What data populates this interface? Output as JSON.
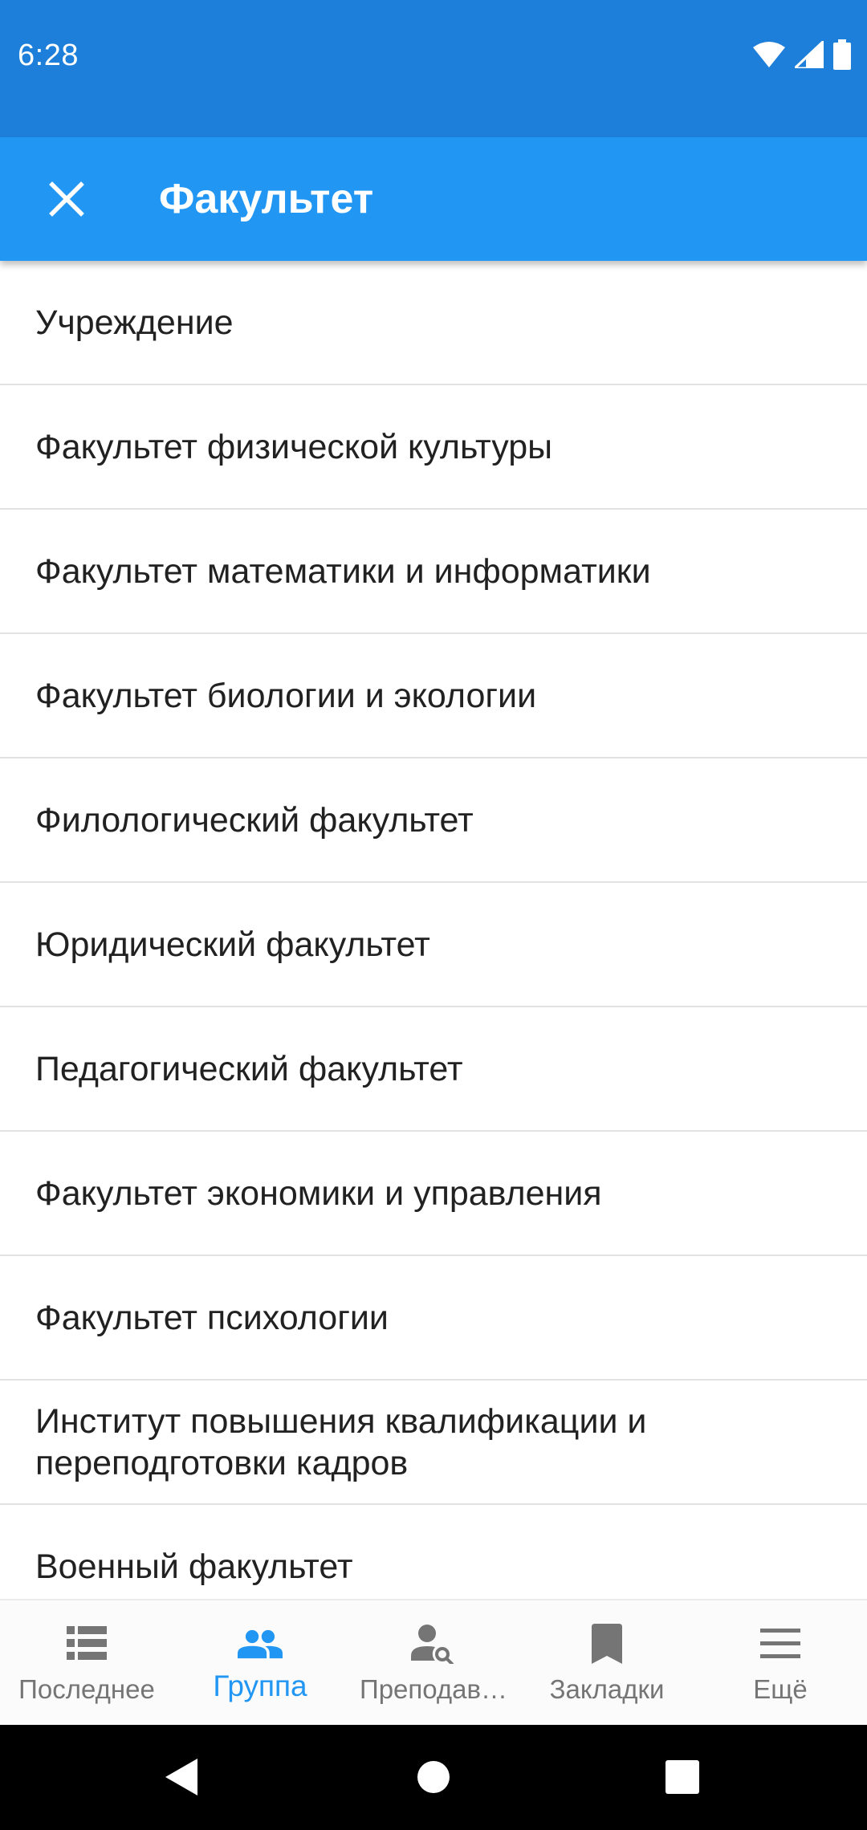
{
  "status_bar": {
    "time": "6:28",
    "icons": [
      "wifi-icon",
      "signal-icon",
      "battery-icon"
    ]
  },
  "app_bar": {
    "close_icon": "close-icon",
    "title": "Факультет"
  },
  "list": {
    "items": [
      {
        "label": "Учреждение"
      },
      {
        "label": "Факультет физической культуры"
      },
      {
        "label": "Факультет математики и информатики"
      },
      {
        "label": "Факультет биологии и экологии"
      },
      {
        "label": "Филологический факультет"
      },
      {
        "label": "Юридический факультет"
      },
      {
        "label": "Педагогический факультет"
      },
      {
        "label": "Факультет экономики и управления"
      },
      {
        "label": "Факультет психологии"
      },
      {
        "label": "Институт повышения квалификации и",
        "label2": "переподготовки кадров"
      },
      {
        "label": "Военный факультет"
      }
    ]
  },
  "bottom_nav": {
    "items": [
      {
        "label": "Последнее",
        "icon": "list-icon",
        "active": false
      },
      {
        "label": "Группа",
        "icon": "group-icon",
        "active": true
      },
      {
        "label": "Преподав…",
        "icon": "teacher-search-icon",
        "active": false
      },
      {
        "label": "Закладки",
        "icon": "bookmark-icon",
        "active": false
      },
      {
        "label": "Ещё",
        "icon": "menu-icon",
        "active": false
      }
    ]
  },
  "system_nav": {
    "icons": [
      "back-icon",
      "home-icon",
      "recents-icon"
    ]
  },
  "colors": {
    "status_bar": "#1e7fdb",
    "app_bar": "#2196f3",
    "accent": "#2196f3",
    "inactive": "#757575",
    "text": "#212121"
  }
}
